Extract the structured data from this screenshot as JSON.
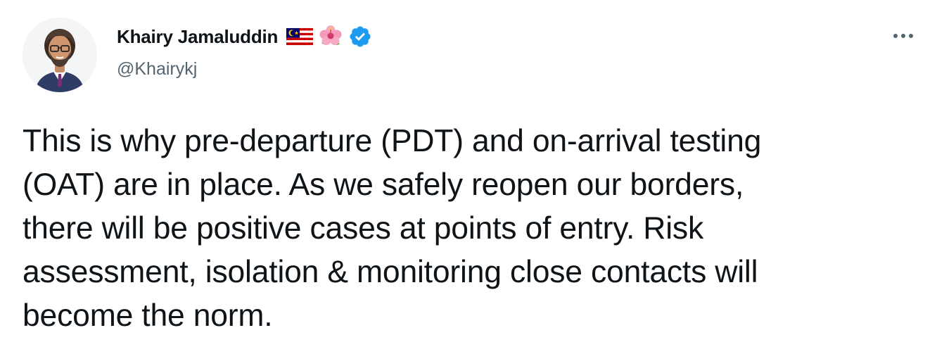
{
  "tweet": {
    "author": {
      "display_name": "Khairy Jamaluddin",
      "handle": "@Khairykj",
      "emoji": [
        "malaysia-flag",
        "hibiscus"
      ],
      "verified": true
    },
    "more_label": "More",
    "text_lines": [
      "This is why pre-departure (PDT) and on-arrival testing",
      "(OAT) are in place. As we safely reopen our borders,",
      "there will be positive cases at points of entry. Risk",
      "assessment, isolation & monitoring close contacts will",
      "become the norm."
    ]
  },
  "colors": {
    "text_primary": "#0f1419",
    "text_secondary": "#536471",
    "verified_blue": "#1d9bf0"
  }
}
